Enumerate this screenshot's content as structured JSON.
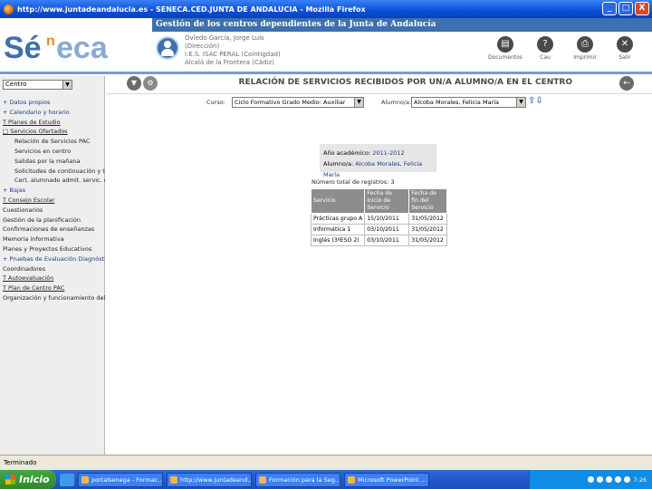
{
  "window": {
    "title": "http://www.juntadeandalucia.es - SENECA.CED.JUNTA DE ANDALUCIA - Mozilla Firefox",
    "buttons": [
      "_",
      "□",
      "X"
    ]
  },
  "header": {
    "logo": "Séneca",
    "banner": "Gestión de los centros dependientes de la Junta de Andalucía",
    "user": [
      "Oviedo García, Jorge Luis",
      "(Dirección)",
      "I.E.S. ISAC PERAL (Coíntigdad)",
      "Alcalá de la Frontera (Cádiz)"
    ],
    "icons": [
      {
        "label": "Documentos",
        "icon": "documents-icon"
      },
      {
        "label": "Cau",
        "icon": "cau-icon"
      },
      {
        "label": "Imprimir",
        "icon": "print-icon"
      },
      {
        "label": "Salir",
        "icon": "exit-icon"
      }
    ]
  },
  "sidebar": {
    "select_value": "Centro",
    "items": [
      {
        "label": "+ Datos propios",
        "level": 0,
        "style": "blue"
      },
      {
        "label": "+ Calendario y horario",
        "level": 0,
        "style": "blue"
      },
      {
        "label": "T Planes de Estudio",
        "level": 0,
        "style": "link"
      },
      {
        "label": "□ Servicios Ofertados",
        "level": 0,
        "style": "link"
      },
      {
        "label": "Relación de Servicios PAC",
        "level": 1,
        "style": ""
      },
      {
        "label": "Servicios en centro",
        "level": 1,
        "style": ""
      },
      {
        "label": "Salidas por la mañana",
        "level": 1,
        "style": ""
      },
      {
        "label": "Solicitudes de continuación y tra",
        "level": 1,
        "style": ""
      },
      {
        "label": "Cert. alumnado admit. servic. cent",
        "level": 1,
        "style": ""
      },
      {
        "label": "+ Bajas",
        "level": 0,
        "style": "blue"
      },
      {
        "label": "T Consejo Escolar",
        "level": 0,
        "style": "link"
      },
      {
        "label": "Cuestionarios",
        "level": 0,
        "style": ""
      },
      {
        "label": "Gestión de la planificación",
        "level": 0,
        "style": ""
      },
      {
        "label": "Confirmaciones de enseñanzas",
        "level": 0,
        "style": ""
      },
      {
        "label": "Memoria informativa",
        "level": 0,
        "style": ""
      },
      {
        "label": "Planes y Proyectos Educativos",
        "level": 0,
        "style": ""
      },
      {
        "label": "+ Pruebas de Evaluación Diagnóstica",
        "level": 0,
        "style": "blue"
      },
      {
        "label": "Coordinadores",
        "level": 0,
        "style": ""
      },
      {
        "label": "T Autoevaluación",
        "level": 0,
        "style": "link"
      },
      {
        "label": "T Plan de Centro PAC",
        "level": 0,
        "style": "link"
      },
      {
        "label": "Organización y funcionamiento del",
        "level": 0,
        "style": ""
      }
    ]
  },
  "page": {
    "title": "RELACIÓN DE SERVICIOS RECIBIDOS POR UN/A ALUMNO/A EN EL CENTRO",
    "filters": {
      "curso_label": "Curso:",
      "curso_value": "Ciclo Formativo Grado Medio: Auxiliar",
      "alumno_label": "Alumno/a:",
      "alumno_value": "Alcoba Morales, Felicia María"
    },
    "info": {
      "year_label": "Año académico:",
      "year_value": "2011-2012",
      "student_label": "Alumno/a:",
      "student_value": "Alcoba Morales, Felicia María"
    },
    "total": "Número total de registros: 3",
    "table": {
      "headers": [
        "Servicio",
        "Fecha de inicio de Servicio",
        "Fecha de fin del Servicio"
      ],
      "rows": [
        [
          "Prácticas grupo A",
          "15/10/2011",
          "31/05/2012"
        ],
        [
          "Informática 1",
          "03/10/2011",
          "31/05/2012"
        ],
        [
          "Inglés (3ºESO 2)",
          "03/10/2011",
          "31/05/2012"
        ]
      ]
    }
  },
  "status": {
    "text": "Terminado"
  },
  "taskbar": {
    "start": "Inicio",
    "tasks": [
      "portalsenega - Formac...",
      "http://www.juntadeand...",
      "Formación para la Seg...",
      "Microsoft PowerPoint ..."
    ],
    "clock": "7:26"
  }
}
